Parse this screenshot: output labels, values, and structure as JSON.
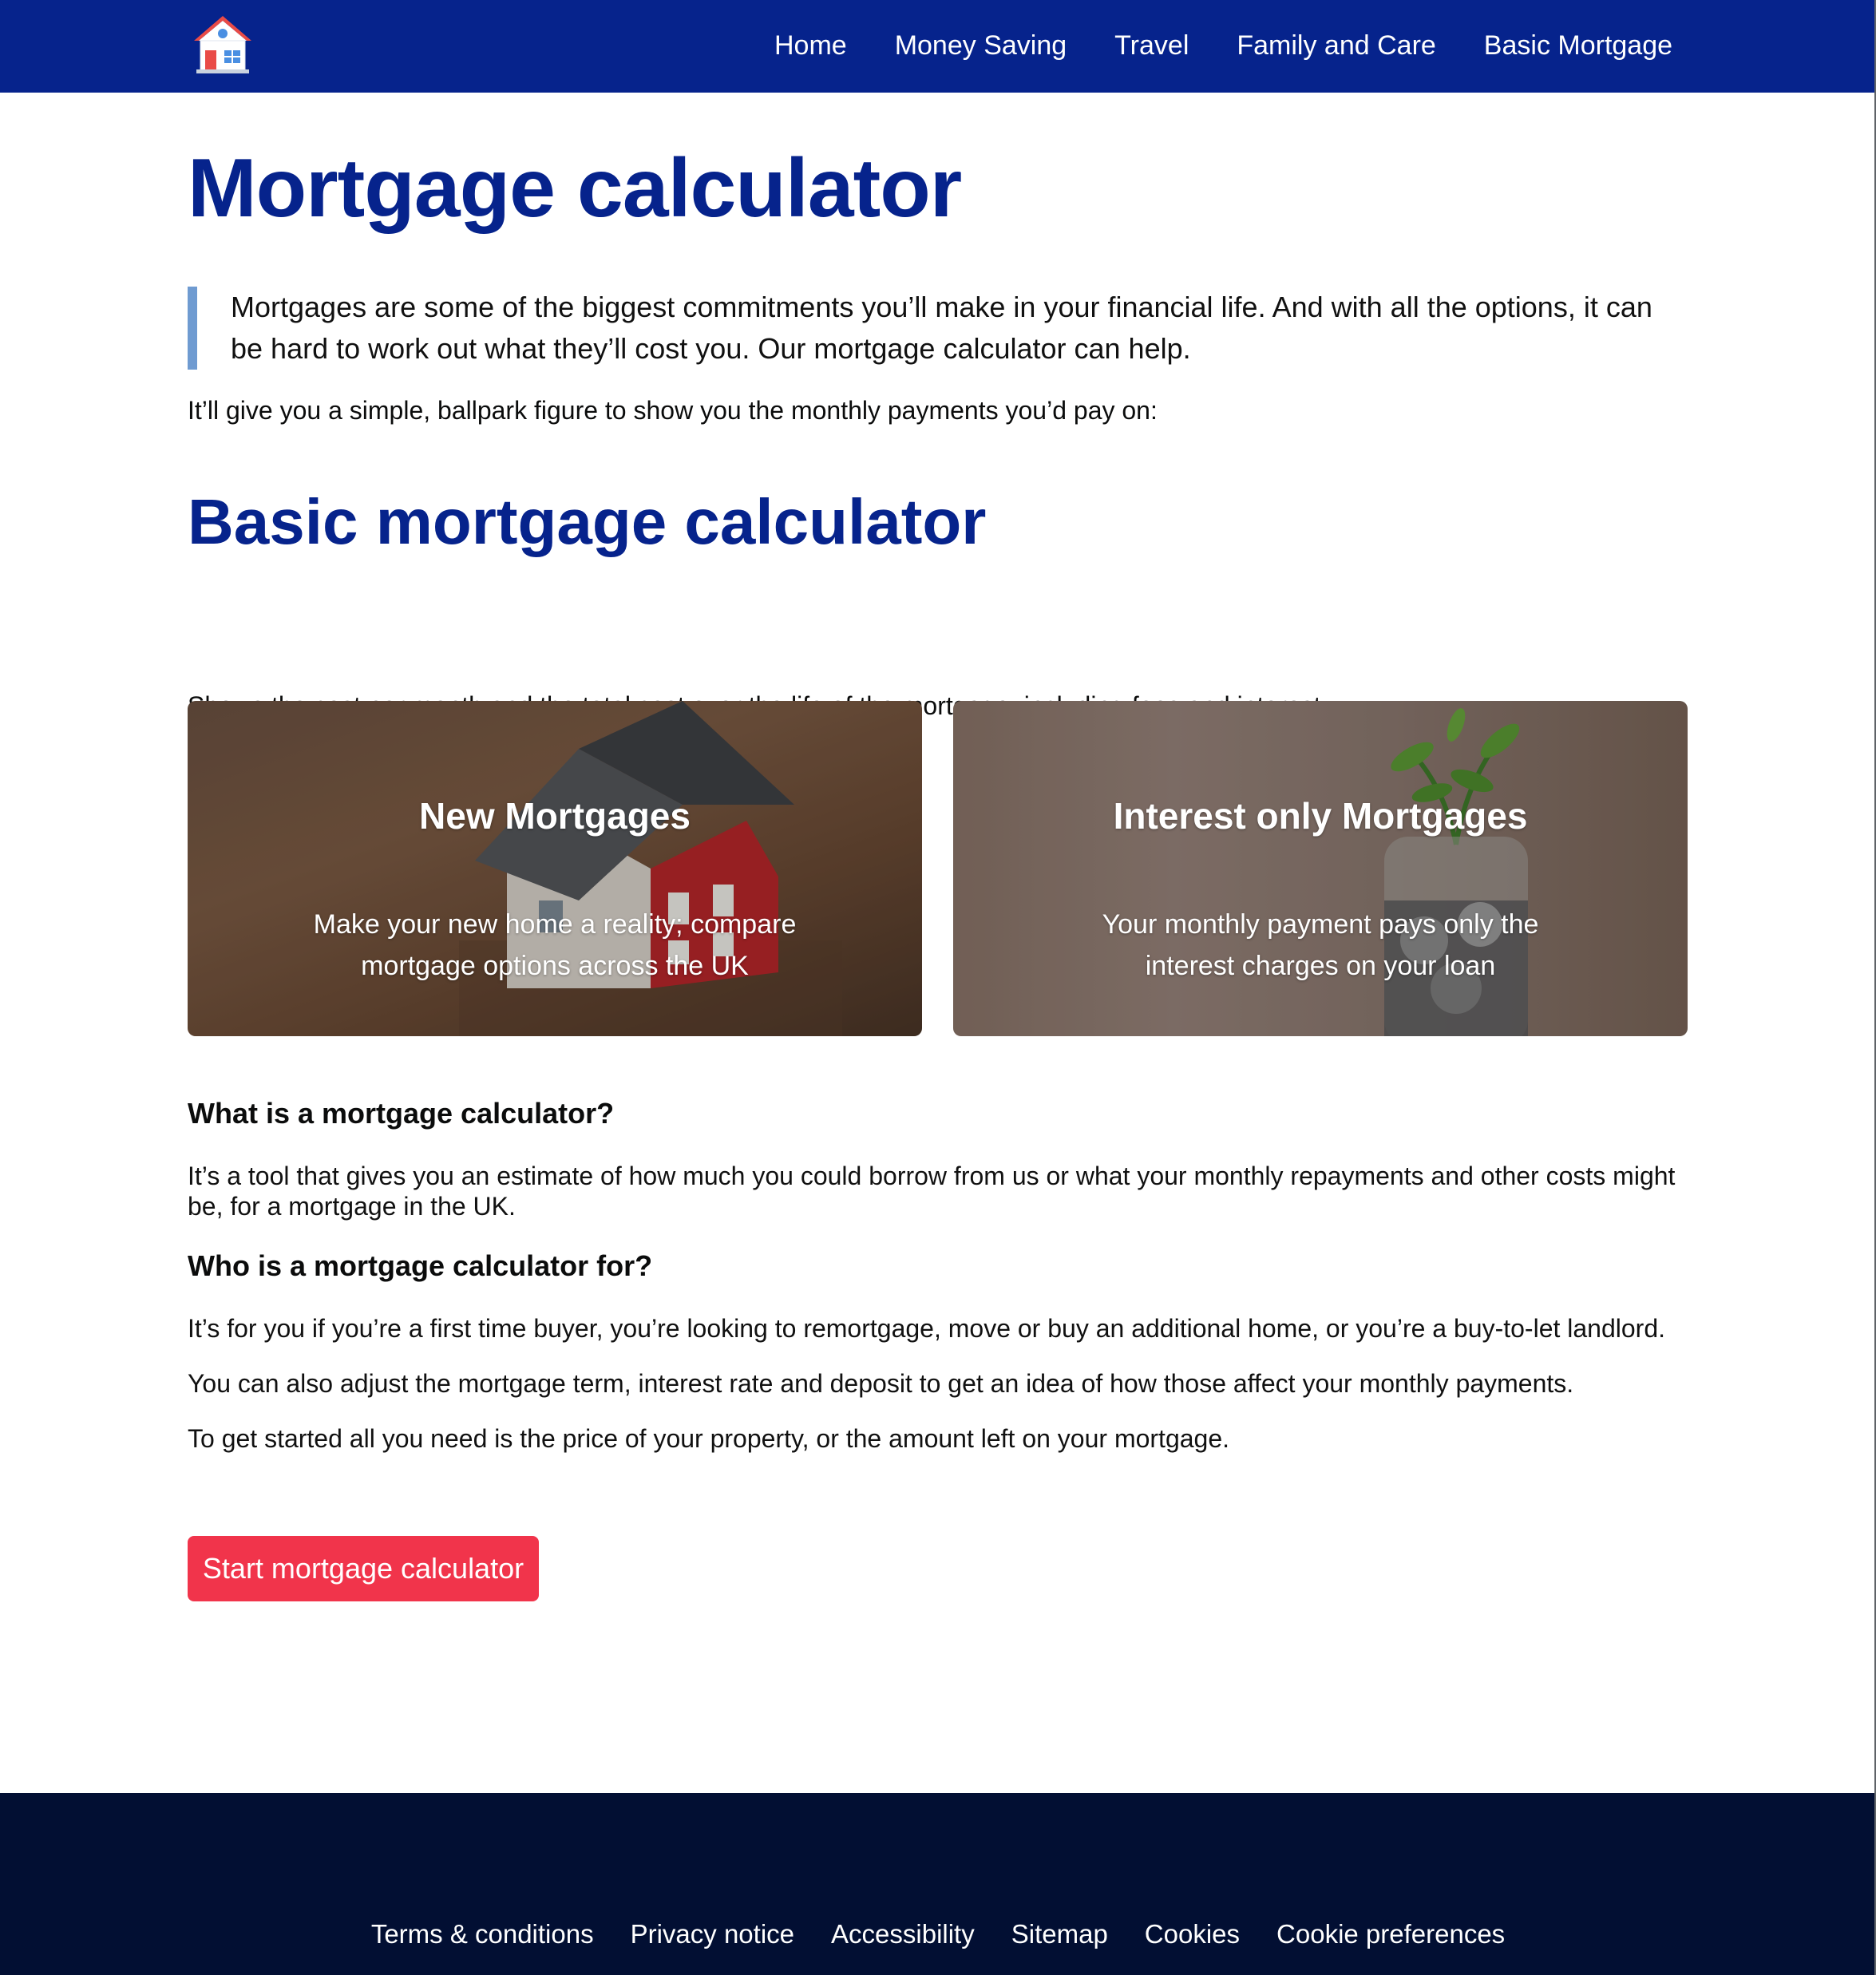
{
  "header": {
    "nav": [
      {
        "label": "Home"
      },
      {
        "label": "Money Saving"
      },
      {
        "label": "Travel"
      },
      {
        "label": "Family and Care"
      },
      {
        "label": "Basic Mortgage"
      }
    ],
    "logo_icon": "house-icon"
  },
  "main": {
    "title": "Mortgage calculator",
    "intro": "Mortgages are some of the biggest commitments you’ll make in your financial life. And with all the options, it can be hard to work out what they’ll cost you. Our mortgage calculator can help.",
    "ballpark": "It’ll give you a simple, ballpark figure to show you the monthly payments you’d pay on:",
    "section_title": "Basic mortgage calculator",
    "section_desc": "Shows the cost per month and the total cost over the life of the mortgage, including fees and interest.",
    "cards": [
      {
        "title": "New Mortgages",
        "text": "Make your new home a reality; compare mortgage options across the UK"
      },
      {
        "title": "Interest only Mortgages",
        "text": "Your monthly payment pays only the interest charges on your loan"
      }
    ],
    "what_title": "What is a mortgage calculator?",
    "what_text": "It’s a tool that gives you an estimate of how much you could borrow from us or what your monthly repayments and other costs might be, for a mortgage in the UK.",
    "who_title": "Who is a mortgage calculator for?",
    "who_text_1": "It’s for you if you’re a first time buyer, you’re looking to remortgage, move or buy an additional home, or you’re a buy-to-let landlord.",
    "who_text_2": "You can also adjust the mortgage term, interest rate and deposit to get an idea of how those affect your monthly payments.",
    "who_text_3": "To get started all you need is the price of your property, or the amount left on your mortgage.",
    "start_button": "Start mortgage calculator"
  },
  "footer": {
    "links": [
      {
        "label": "Terms & conditions"
      },
      {
        "label": "Privacy notice"
      },
      {
        "label": "Accessibility"
      },
      {
        "label": "Sitemap"
      },
      {
        "label": "Cookies"
      },
      {
        "label": "Cookie preferences"
      }
    ]
  },
  "colors": {
    "brand_blue": "#06238c",
    "footer_navy": "#020f33",
    "cta_red": "#f1344b",
    "quote_bar": "#6f9bd1"
  }
}
